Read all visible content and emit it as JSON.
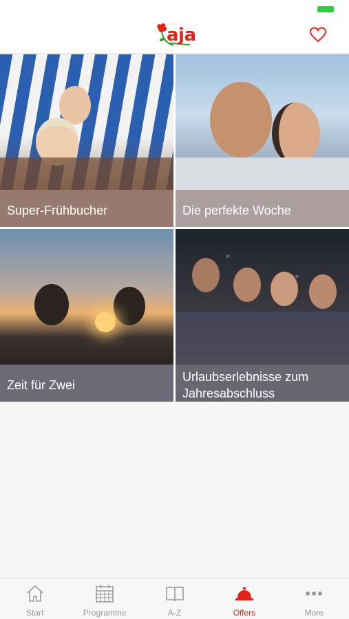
{
  "app": {
    "logo_text": "aja"
  },
  "colors": {
    "brand": "#e2231a",
    "tab_inactive": "#9a9a9a",
    "battery": "#2ecc40"
  },
  "header": {
    "favorites_icon": "heart-outline-icon"
  },
  "offers": [
    {
      "title": "Super-Frühbucher"
    },
    {
      "title": "Die perfekte Woche"
    },
    {
      "title": "Zeit für Zwei"
    },
    {
      "title": "Urlaubserlebnisse zum Jahresabschluss"
    }
  ],
  "tabs": [
    {
      "label": "Start",
      "icon": "house-icon",
      "active": false
    },
    {
      "label": "Programme",
      "icon": "calendar-icon",
      "active": false
    },
    {
      "label": "A-Z",
      "icon": "book-icon",
      "active": false
    },
    {
      "label": "Offers",
      "icon": "service-bell-icon",
      "active": true
    },
    {
      "label": "More",
      "icon": "more-dots-icon",
      "active": false
    }
  ]
}
